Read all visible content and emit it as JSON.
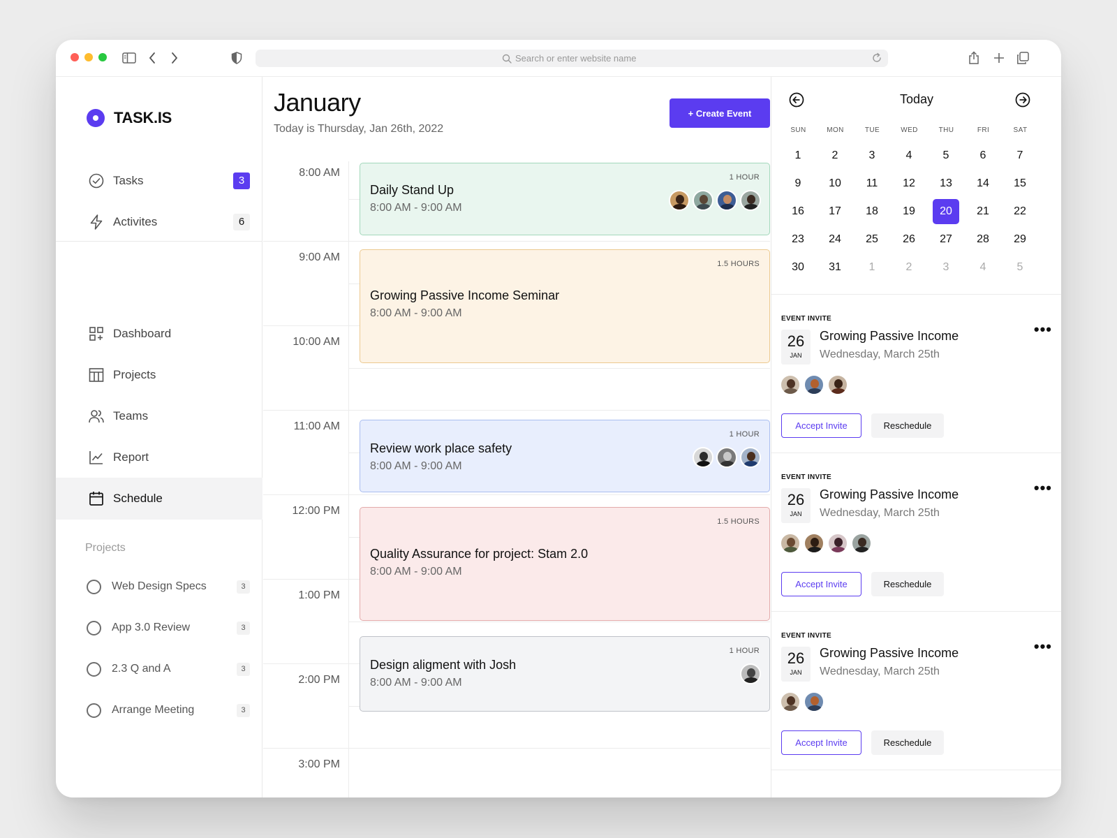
{
  "browser": {
    "address_placeholder": "Search or enter website name",
    "traffic_colors": [
      "#ff5f57",
      "#febc2e",
      "#28c840"
    ]
  },
  "sidebar": {
    "logo": "TASK.IS",
    "top_items": [
      {
        "label": "Tasks",
        "badge": "3",
        "icon": "check-circle-icon"
      },
      {
        "label": "Activites",
        "badge": "6",
        "icon": "lightning-icon"
      }
    ],
    "nav": [
      {
        "label": "Dashboard",
        "icon": "dashboard-icon"
      },
      {
        "label": "Projects",
        "icon": "table-icon"
      },
      {
        "label": "Teams",
        "icon": "users-icon"
      },
      {
        "label": "Report",
        "icon": "chart-line-icon"
      },
      {
        "label": "Schedule",
        "icon": "calendar-icon",
        "active": true
      }
    ],
    "projects_heading": "Projects",
    "projects": [
      {
        "label": "Web Design Specs",
        "count": "3"
      },
      {
        "label": "App 3.0 Review",
        "count": "3"
      },
      {
        "label": "2.3 Q and A",
        "count": "3"
      },
      {
        "label": "Arrange Meeting",
        "count": "3"
      }
    ]
  },
  "main": {
    "month": "January",
    "today_text": "Today is Thursday, Jan 26th, 2022",
    "create_button": "+ Create Event",
    "time_labels": [
      "8:00 AM",
      "9:00 AM",
      "10:00 AM",
      "11:00 AM",
      "12:00 PM",
      "1:00 PM",
      "2:00 PM",
      "3:00 PM"
    ],
    "events": [
      {
        "title": "Daily Stand Up",
        "time": "8:00 AM - 9:00 AM",
        "duration": "1 HOUR",
        "color": "#e9f6ef",
        "border": "#a3d8bb"
      },
      {
        "title": "Growing Passive Income Seminar",
        "time": "8:00 AM - 9:00 AM",
        "duration": "1.5 HOURS",
        "color": "#fdf3e5",
        "border": "#ecc98f"
      },
      {
        "title": "Review work place safety",
        "time": "8:00 AM - 9:00 AM",
        "duration": "1 HOUR",
        "color": "#e8eefd",
        "border": "#a9bdf0"
      },
      {
        "title": "Quality Assurance for project: Stam 2.0",
        "time": "8:00 AM - 9:00 AM",
        "duration": "1.5 HOURS",
        "color": "#fbeaea",
        "border": "#e3aaaa"
      },
      {
        "title": "Design aligment with Josh",
        "time": "8:00 AM - 9:00 AM",
        "duration": "1 HOUR",
        "color": "#f3f4f6",
        "border": "#bfc2c8"
      }
    ]
  },
  "calendar": {
    "title": "Today",
    "dow": [
      "SUN",
      "MON",
      "TUE",
      "WED",
      "THU",
      "FRI",
      "SAT"
    ],
    "weeks": [
      [
        "1",
        "2",
        "3",
        "4",
        "5",
        "6",
        "7"
      ],
      [
        "9",
        "10",
        "11",
        "12",
        "13",
        "14",
        "15"
      ],
      [
        "16",
        "17",
        "18",
        "19",
        "20",
        "21",
        "22"
      ],
      [
        "23",
        "24",
        "25",
        "26",
        "27",
        "28",
        "29"
      ],
      [
        "30",
        "31",
        "1",
        "2",
        "3",
        "4",
        "5"
      ]
    ],
    "selected": "20",
    "accent": "#5b3cf0"
  },
  "invites": [
    {
      "kicker": "EVENT INVITE",
      "day": "26",
      "month": "JAN",
      "title": "Growing Passive Income",
      "subtitle": "Wednesday, March 25th",
      "accept": "Accept Invite",
      "reschedule": "Reschedule",
      "more": "•••"
    },
    {
      "kicker": "EVENT INVITE",
      "day": "26",
      "month": "JAN",
      "title": "Growing Passive Income",
      "subtitle": "Wednesday, March 25th",
      "accept": "Accept Invite",
      "reschedule": "Reschedule",
      "more": "•••"
    },
    {
      "kicker": "EVENT INVITE",
      "day": "26",
      "month": "JAN",
      "title": "Growing Passive Income",
      "subtitle": "Wednesday, March 25th",
      "accept": "Accept Invite",
      "reschedule": "Reschedule",
      "more": "•••"
    }
  ]
}
